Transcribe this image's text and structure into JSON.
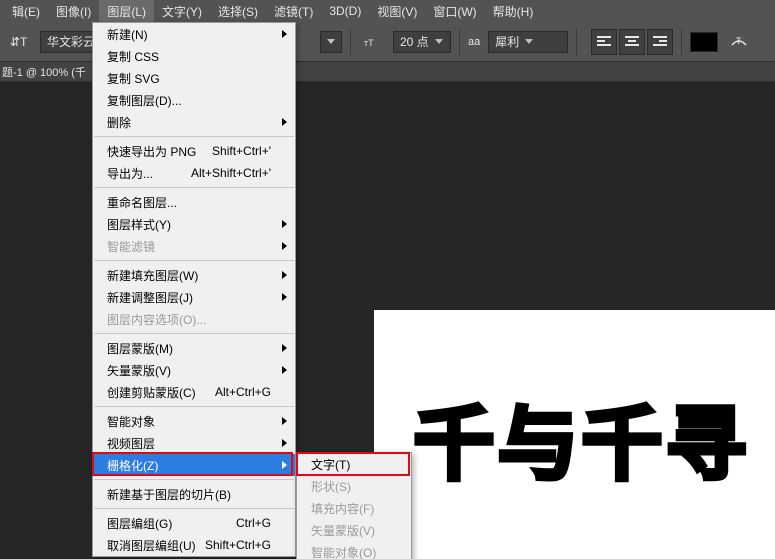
{
  "menubar": {
    "items": [
      "辑(E)",
      "图像(I)",
      "图层(L)",
      "文字(Y)",
      "选择(S)",
      "滤镜(T)",
      "3D(D)",
      "视图(V)",
      "窗口(W)",
      "帮助(H)"
    ]
  },
  "optionsbar": {
    "font_family": "华文彩云",
    "font_size": "20 点",
    "antialias_label": "aa",
    "antialias_value": "犀利"
  },
  "tab": {
    "title": "题-1 @ 100% (千"
  },
  "canvas": {
    "text": "千与千寻"
  },
  "layer_menu": {
    "g1": [
      {
        "label": "新建(N)",
        "arrow": true
      },
      {
        "label": "复制 CSS"
      },
      {
        "label": "复制 SVG"
      },
      {
        "label": "复制图层(D)..."
      },
      {
        "label": "删除",
        "arrow": true
      }
    ],
    "g2": [
      {
        "label": "快速导出为 PNG",
        "shortcut": "Shift+Ctrl+'"
      },
      {
        "label": "导出为...",
        "shortcut": "Alt+Shift+Ctrl+'"
      }
    ],
    "g3": [
      {
        "label": "重命名图层..."
      },
      {
        "label": "图层样式(Y)",
        "arrow": true
      },
      {
        "label": "智能滤镜",
        "arrow": true,
        "disabled": true
      }
    ],
    "g4": [
      {
        "label": "新建填充图层(W)",
        "arrow": true
      },
      {
        "label": "新建调整图层(J)",
        "arrow": true
      },
      {
        "label": "图层内容选项(O)...",
        "disabled": true
      }
    ],
    "g5": [
      {
        "label": "图层蒙版(M)",
        "arrow": true
      },
      {
        "label": "矢量蒙版(V)",
        "arrow": true
      },
      {
        "label": "创建剪贴蒙版(C)",
        "shortcut": "Alt+Ctrl+G"
      }
    ],
    "g6": [
      {
        "label": "智能对象",
        "arrow": true
      },
      {
        "label": "视频图层",
        "arrow": true
      },
      {
        "label": "栅格化(Z)",
        "arrow": true,
        "hover": true
      }
    ],
    "g7": [
      {
        "label": "新建基于图层的切片(B)"
      }
    ],
    "g8": [
      {
        "label": "图层编组(G)",
        "shortcut": "Ctrl+G"
      },
      {
        "label": "取消图层编组(U)",
        "shortcut": "Shift+Ctrl+G"
      }
    ]
  },
  "sub_menu": {
    "items": [
      {
        "label": "文字(T)"
      },
      {
        "label": "形状(S)",
        "disabled": true
      },
      {
        "label": "填充内容(F)",
        "disabled": true
      },
      {
        "label": "矢量蒙版(V)",
        "disabled": true
      },
      {
        "label": "智能对象(O)",
        "disabled": true
      }
    ]
  }
}
